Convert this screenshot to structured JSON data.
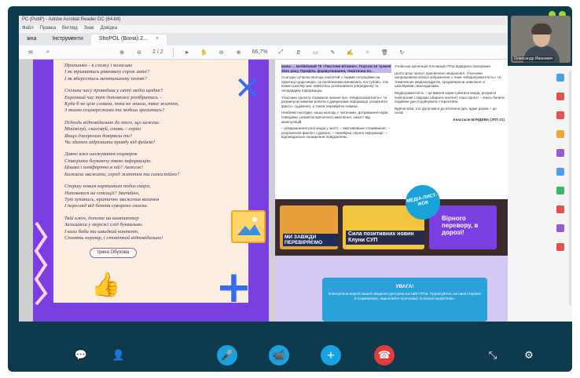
{
  "viewer": {
    "title_text": "PC (PubP) - Adobe Acrobat Reader DC (64-bit)",
    "menu": [
      "Файл",
      "Правка",
      "Вигляд",
      "Знак",
      "Довідка"
    ],
    "tabs": [
      {
        "label": "Інструменти",
        "active": false
      },
      {
        "label": "ShоPOL (Віхна) 2...",
        "active": true
      }
    ],
    "page_indicator": "2 / 2",
    "zoom": "66,7%"
  },
  "poem": {
    "stanzas": [
      [
        "Припиняю - я схожу і колосько",
        "І як триматись рівновагу сорок зміні?",
        "І як вберегтись ментальному позові?"
      ],
      [
        "Скільки часу проводиш у світі медіа щодня?",
        "Екранний час тут допоможе розібратись –",
        "Куди б не ціле словам, поки не знаєш, твое життя,",
        "З якими соцмережами ти любиш зразитись?"
      ],
      [
        "Підходь відповідально до того, що кажеш:",
        "Мінімізуй, скасовуй, ставь – серйо",
        "Якщо джерелам довіряєш ти?",
        "Чи здатен відрізнити правду від фейків?"
      ],
      [
        "Давно вже шолкування соцмерок",
        "Створити блукаючу твою інформацію.",
        "Цікаво і комфортно в ній? Авжеж!",
        "Бажаєш зважити, серед життям ти самостійно?"
      ],
      [
        "Спершу новим картинкам подиз скоро,",
        "Наповнюся на сенсації? Звичайно,",
        "Тут зупинись, критично зважения вагання",
        "І перегляд від бентів суворено скоєна."
      ],
      [
        "Твій ключ, допоте на компюютер",
        "Залишаєш у мережі слід буквально.",
        "І коли баби ти швидкий контент,",
        "Споміть перевір, і стовіткой відповідально!"
      ]
    ],
    "author": "Ірина Обухова"
  },
  "article": {
    "col1": [
      {
        "type": "hl",
        "text": "Ірина ... Шлійкієвий 75 «Текстове вітання», Портам 16 травня 2021 року, Профіль формулювання, тематична по..."
      },
      {
        "type": "p",
        "text": "Сьогодні сучасна молодь заклятий з такими ситуаціями на практиці щодо медіа. Ці проблемами виникають поступово, тож кожен школяр має навчитись розпізнавати упереджену та неправдиву інформацію."
      },
      {
        "type": "p",
        "text": "Учасники проєкту отримали знання про «Медіаграмотність» та розвинули навички роботи з джерелами інформації, розрізняти факти і судження, а також перевіряти новини."
      },
      {
        "type": "p",
        "text": "Неабиякі наслідки: наша молодь є читачами, дотримання норм поведінки, розвиток критичного мислення, захист від маніпуляцій."
      },
      {
        "type": "p",
        "text": "– усвідомлення ролі медіа у житті; – вмотивоване споживання; – розрізнення фактів і суджень; – перевірка спірної інформації; – відповідальне поширення повідомлень."
      }
    ],
    "col2": [
      {
        "type": "p",
        "text": "Учнівська делегація посланців ПТШ відвідала Запоріжжя."
      },
      {
        "type": "p",
        "text": "Цього року проєкт присвячено медіаосвіті. Учасники напрацювали власні зображення з теми «Медіаграмотність» та тематичних медіапродуктів, продовжуючи навчання зі школярами і викладачами."
      },
      {
        "type": "p",
        "text": "Медіаграмотність – це вміння користуватися медіа, розуміти їхній вплив і свідомо обирати контент. Наш проєкт – вчить бачити подвійне дно й руйнувати стереотипи."
      },
      {
        "type": "p",
        "text": "Вдячні всім, хто долучився до втілення ідеї, адже разом – це сила!"
      },
      {
        "type": "sig",
        "text": "Анастасія БУНДЕВА (ЗПТ-21)"
      }
    ],
    "media_badge": "МЕДІА-ЛИСТ-ЖОК",
    "banners": [
      {
        "label": "МИ ЗАВЖДИ ПЕРЕВІРЯЄМО"
      },
      {
        "label": "Сила позитивних новин Клуни СУП"
      },
      {
        "label": "Вірного перевору, в дорозі!"
      }
    ],
    "notice_title": "УВАГА!",
    "notice_text": "Електронна версія нашого видання доступна на сайті ПТШ. Підписуйтесь на наші сторінки в соцмережах, надсилайте пропозиції та власні медіатвори."
  },
  "participant": {
    "name": "Олександр Иванович"
  },
  "call_controls": [
    {
      "name": "chat-icon",
      "glyph": "💬"
    },
    {
      "name": "add-person-icon",
      "glyph": "⊕"
    },
    {
      "name": "microphone-icon",
      "glyph": "🎤"
    },
    {
      "name": "video-camera-icon",
      "glyph": "📹"
    },
    {
      "name": "plus-icon",
      "glyph": "+"
    },
    {
      "name": "hang-up-icon",
      "glyph": "☎"
    },
    {
      "name": "minimize-icon",
      "glyph": "⤡"
    },
    {
      "name": "settings-gear-icon",
      "glyph": "⚙"
    }
  ],
  "colors": {
    "stage": "#0e3a4e",
    "accent_blue": "#1aa1e0",
    "hangup_red": "#e23b3b",
    "poem_purple": "#7a3fe0"
  }
}
